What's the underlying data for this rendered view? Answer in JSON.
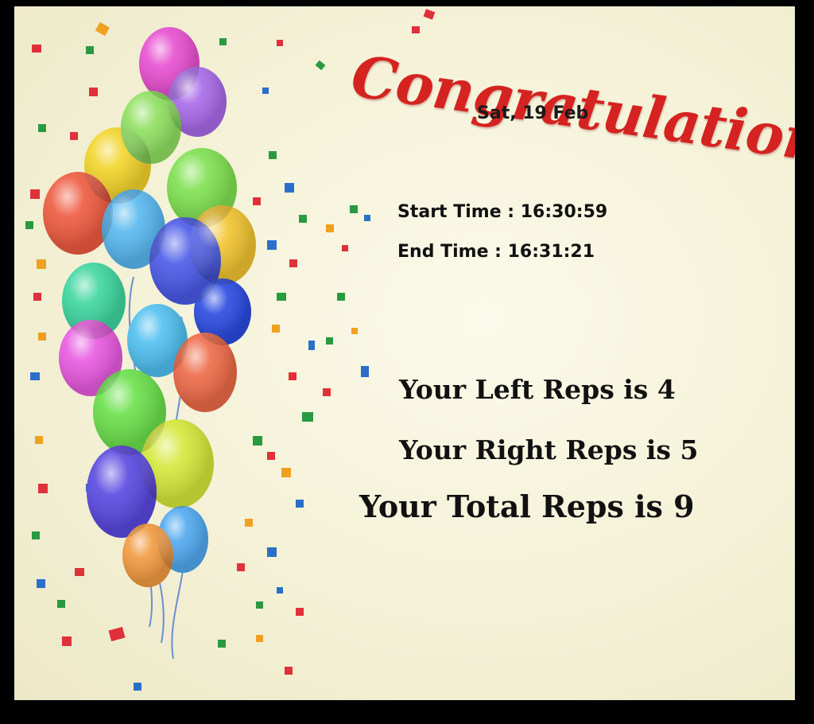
{
  "title": "Congratulations!",
  "date": "Sat, 19 Feb",
  "start_time": "Start Time : 16:30:59",
  "end_time": "End Time : 16:31:21",
  "left_reps": "Your Left Reps is 4",
  "right_reps": "Your Right Reps is 5",
  "total_reps": "Your Total Reps is 9",
  "colors": {
    "title": "#d42320",
    "background": "#f4f1d6",
    "frame": "#000000"
  }
}
